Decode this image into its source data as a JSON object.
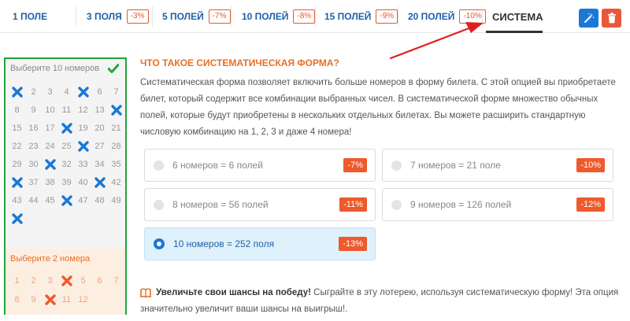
{
  "tabs": [
    {
      "label": "1 ПОЛЕ",
      "discount": ""
    },
    {
      "label": "3 ПОЛЯ",
      "discount": "-3%"
    },
    {
      "label": "5 ПОЛЕЙ",
      "discount": "-7%"
    },
    {
      "label": "10 ПОЛЕЙ",
      "discount": "-8%"
    },
    {
      "label": "15 ПОЛЕЙ",
      "discount": "-9%"
    },
    {
      "label": "20 ПОЛЕЙ",
      "discount": "-10%"
    },
    {
      "label": "СИСТЕМА",
      "discount": "",
      "active": true
    }
  ],
  "toolbar": {
    "magic_icon": "magic-wand-icon",
    "trash_icon": "trash-icon",
    "accent": "#1c78d4",
    "danger": "#e8593a"
  },
  "ticket": {
    "main_title": "Выберите 10 номеров",
    "numbers": [
      1,
      2,
      3,
      4,
      5,
      6,
      7,
      8,
      9,
      10,
      11,
      12,
      13,
      14,
      15,
      16,
      17,
      18,
      19,
      20,
      21,
      22,
      23,
      24,
      25,
      26,
      27,
      28,
      29,
      30,
      31,
      32,
      33,
      34,
      35,
      36,
      37,
      38,
      39,
      40,
      41,
      42,
      43,
      44,
      45,
      46,
      47,
      48,
      49,
      50
    ],
    "selected": [
      1,
      5,
      14,
      18,
      26,
      31,
      36,
      41,
      46,
      50
    ],
    "bonus_title": "Выберите 2 номера",
    "bonus_numbers": [
      1,
      2,
      3,
      4,
      5,
      6,
      7,
      8,
      9,
      10,
      11,
      12
    ],
    "bonus_selected": [
      4,
      10
    ],
    "border_color": "#1ea63a",
    "mark_color": "#1c78d4",
    "bonus_mark_color": "#ee5a2c"
  },
  "main": {
    "heading": "ЧТО ТАКОЕ СИСТЕМАТИЧЕСКАЯ ФОРМА?",
    "paragraph": "Систематическая форма позволяет включить больше номеров в форму билета. С этой опцией вы приобретаете билет, который содержит все комбинации выбранных чисел. В систематической форме множество обычных полей, которые будут приобретены в нескольких отдельных билетах. Вы можете расширить стандартную числовую комбинацию на 1, 2, 3 и даже 4 номера!",
    "options": [
      {
        "label": "6 номеров = 6 полей",
        "discount": "-7%",
        "selected": false
      },
      {
        "label": "7 номеров = 21 поле",
        "discount": "-10%",
        "selected": false
      },
      {
        "label": "8 номеров = 56 полей",
        "discount": "-11%",
        "selected": false
      },
      {
        "label": "9 номеров = 126 полей",
        "discount": "-12%",
        "selected": false
      },
      {
        "label": "10 номеров = 252 поля",
        "discount": "-13%",
        "selected": true
      }
    ],
    "tip_bold": "Увеличьте свои шансы на победу!",
    "tip_text": " Сыграйте в эту лотерею, используя систематическую форму! Эта опция значительно увеличит ваши шансы на выигрыш!."
  }
}
